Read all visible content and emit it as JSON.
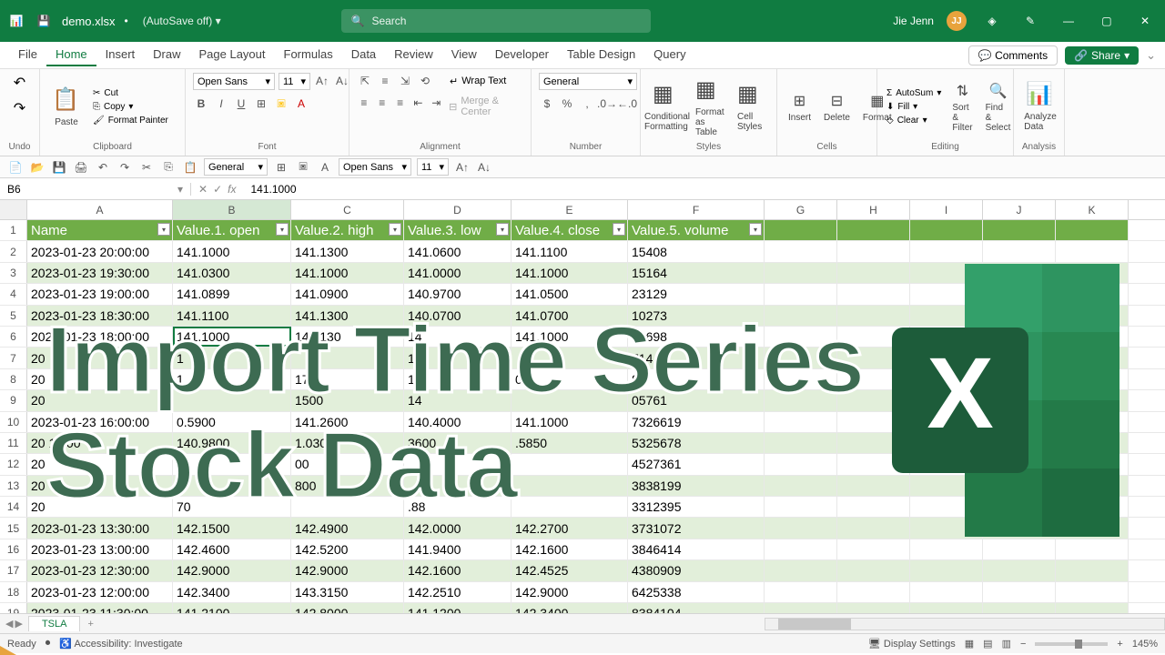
{
  "titlebar": {
    "filename": "demo.xlsx",
    "autosave": "(AutoSave off)",
    "search_placeholder": "Search",
    "username": "Jie Jenn",
    "initials": "JJ"
  },
  "tabs": {
    "items": [
      "File",
      "Home",
      "Insert",
      "Draw",
      "Page Layout",
      "Formulas",
      "Data",
      "Review",
      "View",
      "Developer",
      "Table Design",
      "Query"
    ],
    "active": 1,
    "comments": "Comments",
    "share": "Share"
  },
  "ribbon": {
    "undo": "Undo",
    "clipboard": "Clipboard",
    "paste": "Paste",
    "cut": "Cut",
    "copy": "Copy",
    "fmt_painter": "Format Painter",
    "font": "Font",
    "font_name": "Open Sans",
    "font_size": "11",
    "alignment": "Alignment",
    "wrap": "Wrap Text",
    "merge": "Merge & Center",
    "number": "Number",
    "num_fmt": "General",
    "styles": "Styles",
    "cond_fmt": "Conditional Formatting",
    "fmt_table": "Format as Table",
    "cell_styles": "Cell Styles",
    "cells": "Cells",
    "insert": "Insert",
    "delete": "Delete",
    "format": "Format",
    "editing": "Editing",
    "autosum": "AutoSum",
    "fill": "Fill",
    "clear": "Clear",
    "sort": "Sort & Filter",
    "find": "Find & Select",
    "analysis": "Analysis",
    "analyze": "Analyze Data"
  },
  "qat2": {
    "num_fmt": "General",
    "font_name": "Open Sans",
    "font_size": "11"
  },
  "formula_bar": {
    "cell_ref": "B6",
    "value": "141.1000"
  },
  "cols": {
    "letters": [
      "A",
      "B",
      "C",
      "D",
      "E",
      "F",
      "G",
      "H",
      "I",
      "J",
      "K"
    ],
    "widths": [
      160,
      130,
      124,
      118,
      128,
      150,
      80,
      80,
      80,
      80,
      80
    ]
  },
  "headers": [
    "Name",
    "Value.1. open",
    "Value.2. high",
    "Value.3. low",
    "Value.4. close",
    "Value.5. volume"
  ],
  "rows": [
    [
      "2023-01-23 20:00:00",
      "141.1000",
      "141.1300",
      "141.0600",
      "141.1100",
      "15408"
    ],
    [
      "2023-01-23 19:30:00",
      "141.0300",
      "141.1000",
      "141.0000",
      "141.1000",
      "15164"
    ],
    [
      "2023-01-23 19:00:00",
      "141.0899",
      "141.0900",
      "140.9700",
      "141.0500",
      "23129"
    ],
    [
      "2023-01-23 18:30:00",
      "141.1100",
      "141.1300",
      "140.0700",
      "141.0700",
      "10273"
    ],
    [
      "2023-01-23 18:00:00",
      "141.1000",
      "141.130",
      "14",
      "141.1000",
      "10698"
    ],
    [
      "20",
      "1",
      "",
      "14",
      "",
      "714"
    ],
    [
      "20",
      "1.",
      "178",
      "14",
      "0",
      "87"
    ],
    [
      "20",
      "",
      "1500",
      "14",
      "",
      "05761"
    ],
    [
      "2023-01-23 16:00:00",
      "0.5900",
      "141.2600",
      "140.4000",
      "141.1000",
      "7326619"
    ],
    [
      "20           15    00",
      "140.9800",
      "1.0300",
      "3600",
      ".5850",
      "5325678"
    ],
    [
      "20",
      "",
      "00",
      "",
      "",
      "4527361"
    ],
    [
      "20",
      "4",
      "800",
      "",
      "",
      "3838199"
    ],
    [
      "20",
      "70",
      "",
      ".88",
      "",
      "3312395"
    ],
    [
      "2023-01-23 13:30:00",
      "142.1500",
      "142.4900",
      "142.0000",
      "142.2700",
      "3731072"
    ],
    [
      "2023-01-23 13:00:00",
      "142.4600",
      "142.5200",
      "141.9400",
      "142.1600",
      "3846414"
    ],
    [
      "2023-01-23 12:30:00",
      "142.9000",
      "142.9000",
      "142.1600",
      "142.4525",
      "4380909"
    ],
    [
      "2023-01-23 12:00:00",
      "142.3400",
      "143.3150",
      "142.2510",
      "142.9000",
      "6425338"
    ],
    [
      "2023-01-23 11:30:00",
      "141.2100",
      "142.8000",
      "141.1200",
      "142.3400",
      "8384104"
    ]
  ],
  "selected": {
    "row": 6,
    "col": 1
  },
  "sheet_tabs": {
    "active": "TSLA"
  },
  "status": {
    "ready": "Ready",
    "access": "Accessibility: Investigate",
    "display": "Display Settings",
    "zoom": "145%"
  },
  "overlay": {
    "line1": "Import Time Series",
    "line2": "Stock Data"
  }
}
